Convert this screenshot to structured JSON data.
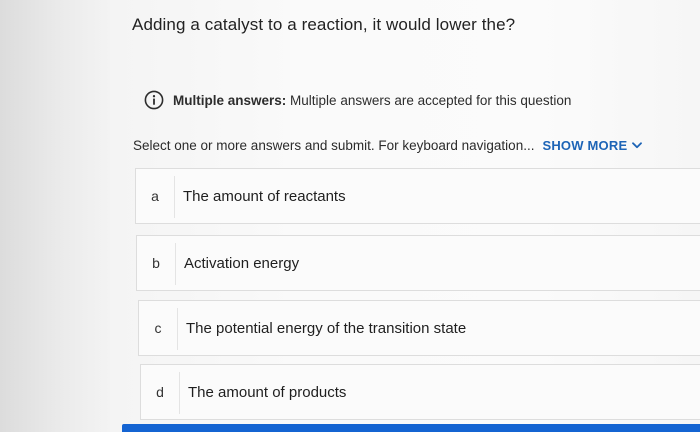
{
  "question": {
    "title": "Adding a catalyst to a reaction, it would lower the?"
  },
  "notice": {
    "icon": "info-icon",
    "label": "Multiple answers:",
    "text": "Multiple answers are accepted for this question"
  },
  "instructions": {
    "text": "Select one or more answers and submit. For keyboard navigation...",
    "show_more_label": "SHOW MORE",
    "show_more_icon": "chevron-down-icon"
  },
  "options": [
    {
      "letter": "a",
      "text": "The amount of reactants"
    },
    {
      "letter": "b",
      "text": "Activation energy"
    },
    {
      "letter": "c",
      "text": "The potential energy of the transition state"
    },
    {
      "letter": "d",
      "text": "The amount of products"
    }
  ],
  "colors": {
    "accent": "#1d64b6",
    "submit_bar": "#1464d2",
    "border": "#dddddd"
  }
}
